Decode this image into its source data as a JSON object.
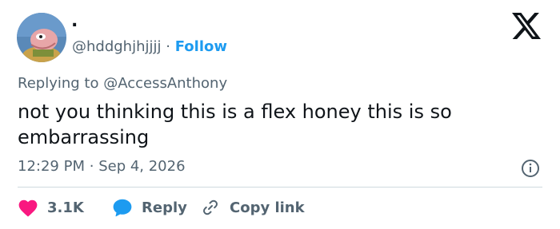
{
  "author": {
    "display_name": ".",
    "handle": "@hddghjhjjjj",
    "separator": "·",
    "follow_label": "Follow"
  },
  "reply_context": {
    "prefix": "Replying to",
    "mention": "@AccessAnthony"
  },
  "tweet": {
    "text": "not you thinking this is a flex honey this is so embarrassing"
  },
  "meta": {
    "time": "12:29 PM",
    "separator": "·",
    "date": "Sep 4, 2026"
  },
  "actions": {
    "likes": "3.1K",
    "reply_label": "Reply",
    "copy_link_label": "Copy link"
  },
  "colors": {
    "accent": "#1d9bf0",
    "like": "#f91880",
    "secondary_text": "#536471",
    "primary_text": "#0f1419",
    "divider": "#cfd9de"
  },
  "icons": {
    "brand": "x-logo-icon",
    "info": "info-icon",
    "like": "heart-icon",
    "reply": "speech-bubble-icon",
    "copy": "link-icon"
  }
}
